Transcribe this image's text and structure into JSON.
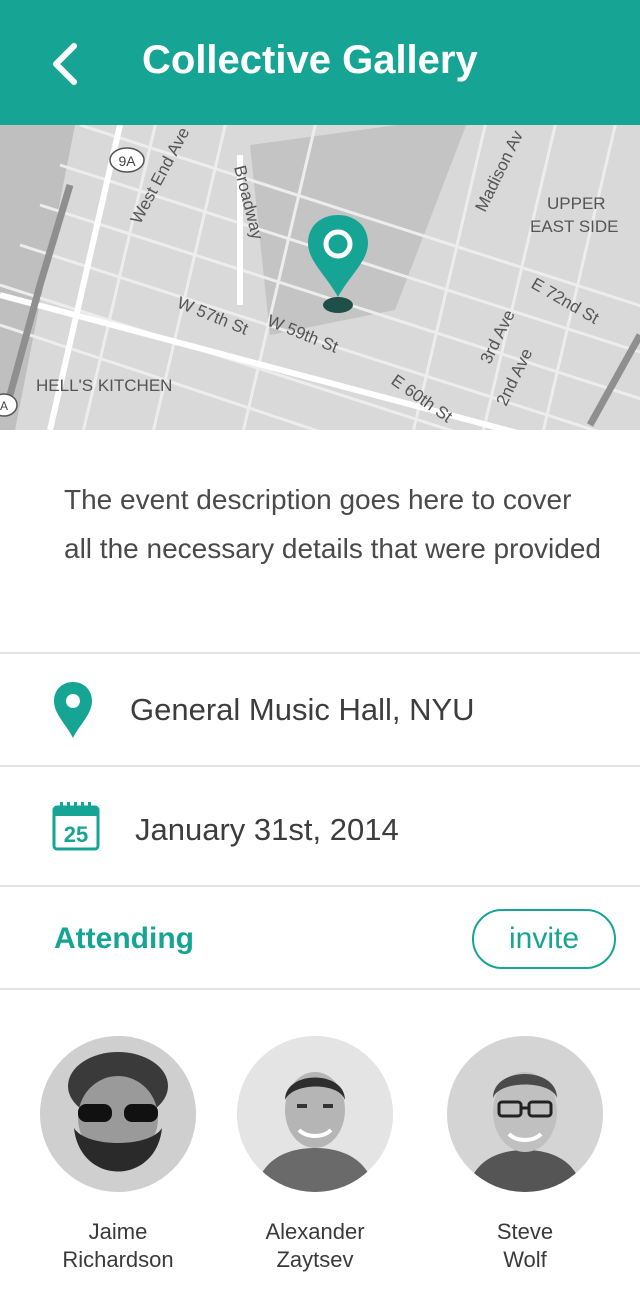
{
  "header": {
    "title": "Collective Gallery",
    "back_icon": "chevron-left-icon"
  },
  "map": {
    "labels": {
      "west_end_ave": "West End Ave",
      "broadway": "Broadway",
      "route_9a": "9A",
      "madison_ave": "Madison Av",
      "upper_east_side_1": "UPPER",
      "upper_east_side_2": "EAST SIDE",
      "w_57th": "W 57th St",
      "w_59th": "W 59th St",
      "e_60th": "E 60th St",
      "e_72nd": "E 72nd St",
      "third_ave": "3rd Ave",
      "second_ave": "2nd Ave",
      "hells_kitchen": "HELL'S KITCHEN",
      "route_a": "A"
    },
    "pin_color": "#16a595"
  },
  "event": {
    "description": "The event description goes here to cover all the necessary details that were provided",
    "location": "General Music Hall, NYU",
    "calendar_day": "25",
    "date": "January 31st, 2014"
  },
  "attending": {
    "label": "Attending",
    "invite_label": "invite",
    "people": [
      {
        "first": "Jaime",
        "last": "Richardson"
      },
      {
        "first": "Alexander",
        "last": "Zaytsev"
      },
      {
        "first": "Steve",
        "last": "Wolf"
      }
    ]
  },
  "colors": {
    "accent": "#16a595",
    "divider": "#e3e3e3",
    "text": "#3d3d3d"
  }
}
